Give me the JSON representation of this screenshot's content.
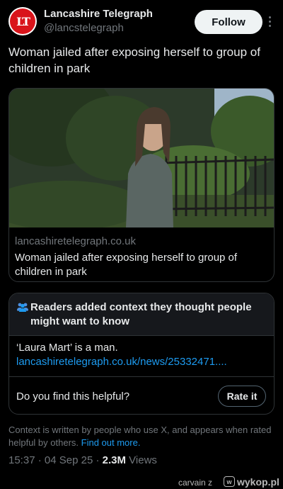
{
  "tweet": {
    "author": {
      "name": "Lancashire Telegraph",
      "handle": "@lancstelegraph",
      "avatar_text": "LT"
    },
    "follow_label": "Follow",
    "more_icon": "more-vertical-icon",
    "text": "Woman jailed after exposing herself to group of children in park",
    "card": {
      "domain": "lancashiretelegraph.co.uk",
      "title": "Woman jailed after exposing herself to group of children in park"
    },
    "community_note": {
      "icon": "people-icon",
      "title": "Readers added context they thought people might want to know",
      "body_text": "‘Laura Mart’ is a man.",
      "link_text": "lancashiretelegraph.co.uk/news/25332471....",
      "helpful_question": "Do you find this helpful?",
      "rate_label": "Rate it"
    },
    "context_info": "Context is written by people who use X, and appears when rated helpful by others.",
    "find_out_more": "Find out more.",
    "time": "15:37",
    "separator": "·",
    "date": "04 Sep 25",
    "views_count": "2.3M",
    "views_label": "Views"
  },
  "watermark": {
    "user": "carvain z",
    "logo": "w",
    "brand": "wykop.pl"
  },
  "colors": {
    "background": "#000000",
    "text": "#e7e9ea",
    "muted": "#71767b",
    "link": "#1d9bf0",
    "border": "#2f3336",
    "brand_red": "#d9141b"
  }
}
